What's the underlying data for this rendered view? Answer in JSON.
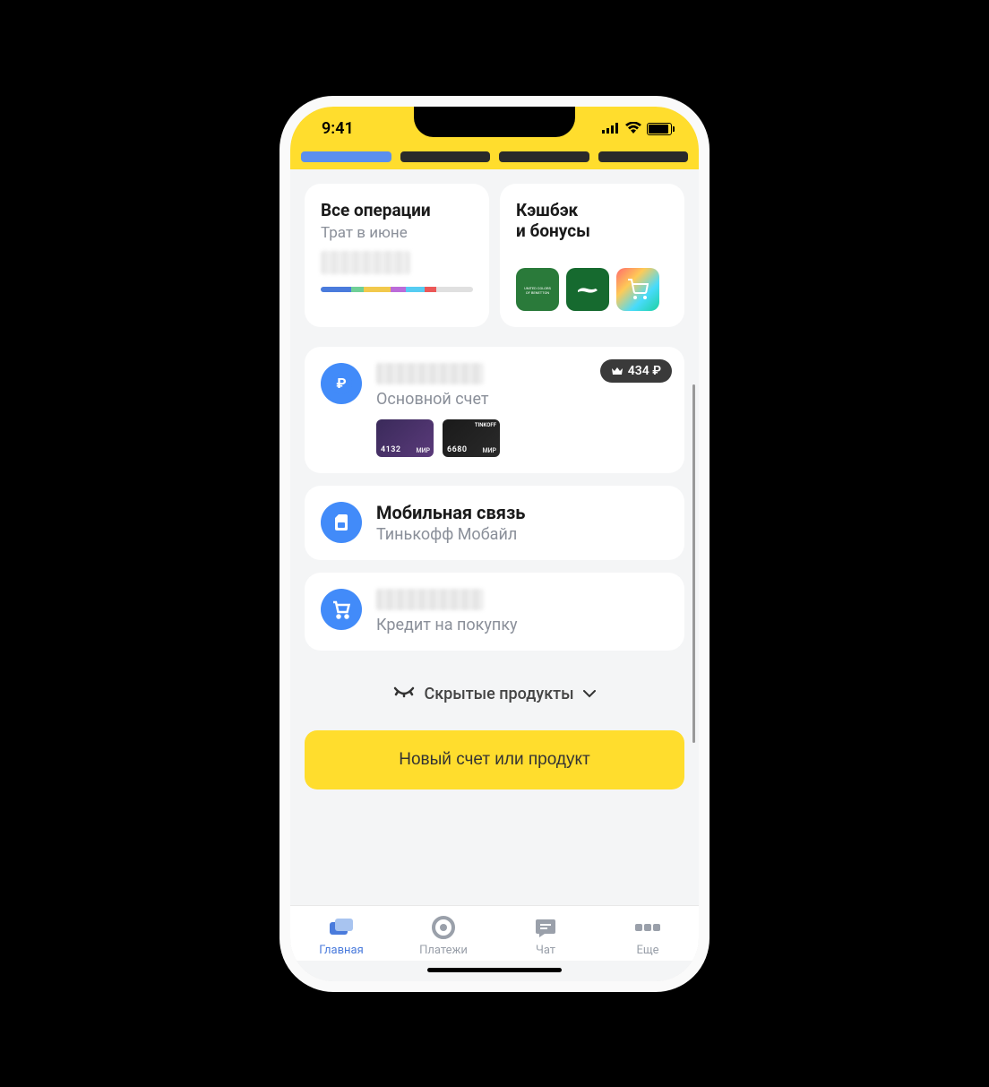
{
  "status": {
    "time": "9:41"
  },
  "ops_card": {
    "title": "Все операции",
    "subtitle": "Трат в июне",
    "segments": [
      {
        "color": "#4a7bdc",
        "width": 20
      },
      {
        "color": "#6fcf97",
        "width": 8
      },
      {
        "color": "#f2c94c",
        "width": 18
      },
      {
        "color": "#bb6bd9",
        "width": 10
      },
      {
        "color": "#56ccf2",
        "width": 12
      },
      {
        "color": "#eb5757",
        "width": 8
      },
      {
        "color": "#e0e0e0",
        "width": 24
      }
    ]
  },
  "cashback_card": {
    "title_line1": "Кэшбэк",
    "title_line2": "и бонусы"
  },
  "accounts": {
    "main": {
      "subtitle": "Основной счет",
      "badge": "434 ₽",
      "cards": [
        {
          "last4": "4132",
          "system": "МИР",
          "bg1": "#3a2a5a",
          "bg2": "#5a3a7a"
        },
        {
          "last4": "6680",
          "system": "МИР",
          "bg1": "#1a1a1a",
          "bg2": "#2a2a2a",
          "brand": "TINKOFF"
        }
      ]
    },
    "mobile": {
      "title": "Мобильная связь",
      "subtitle": "Тинькофф Мобайл"
    },
    "credit": {
      "subtitle": "Кредит на покупку"
    }
  },
  "hidden_products": "Скрытые продукты",
  "cta": "Новый счет или продукт",
  "tabs": [
    {
      "label": "Главная",
      "icon": "home"
    },
    {
      "label": "Платежи",
      "icon": "payments"
    },
    {
      "label": "Чат",
      "icon": "chat"
    },
    {
      "label": "Еще",
      "icon": "more"
    }
  ]
}
